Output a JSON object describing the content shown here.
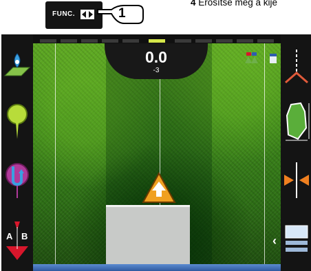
{
  "top": {
    "func_label": "FUNC.",
    "callout_number": "1",
    "instruction_step": "4",
    "instruction_text": " Erősítse meg a kije"
  },
  "readout": {
    "value": "0.0",
    "offset": "-3"
  },
  "left_toolbar": {
    "items": [
      "map-layer-icon",
      "pin-marker-icon",
      "u-turn-icon",
      "ab-line-icon"
    ],
    "ab_labels": [
      "A",
      "B"
    ]
  },
  "right_toolbar": {
    "items": [
      "sections-icon",
      "field-boundary-icon",
      "guidance-shift-icon",
      "display-toggle-icon"
    ]
  },
  "colors": {
    "field_green": "#3f8a1b",
    "vehicle_orange": "#f0a020",
    "accent_yellow": "#d4e64a",
    "ab_red": "#d8162b"
  }
}
